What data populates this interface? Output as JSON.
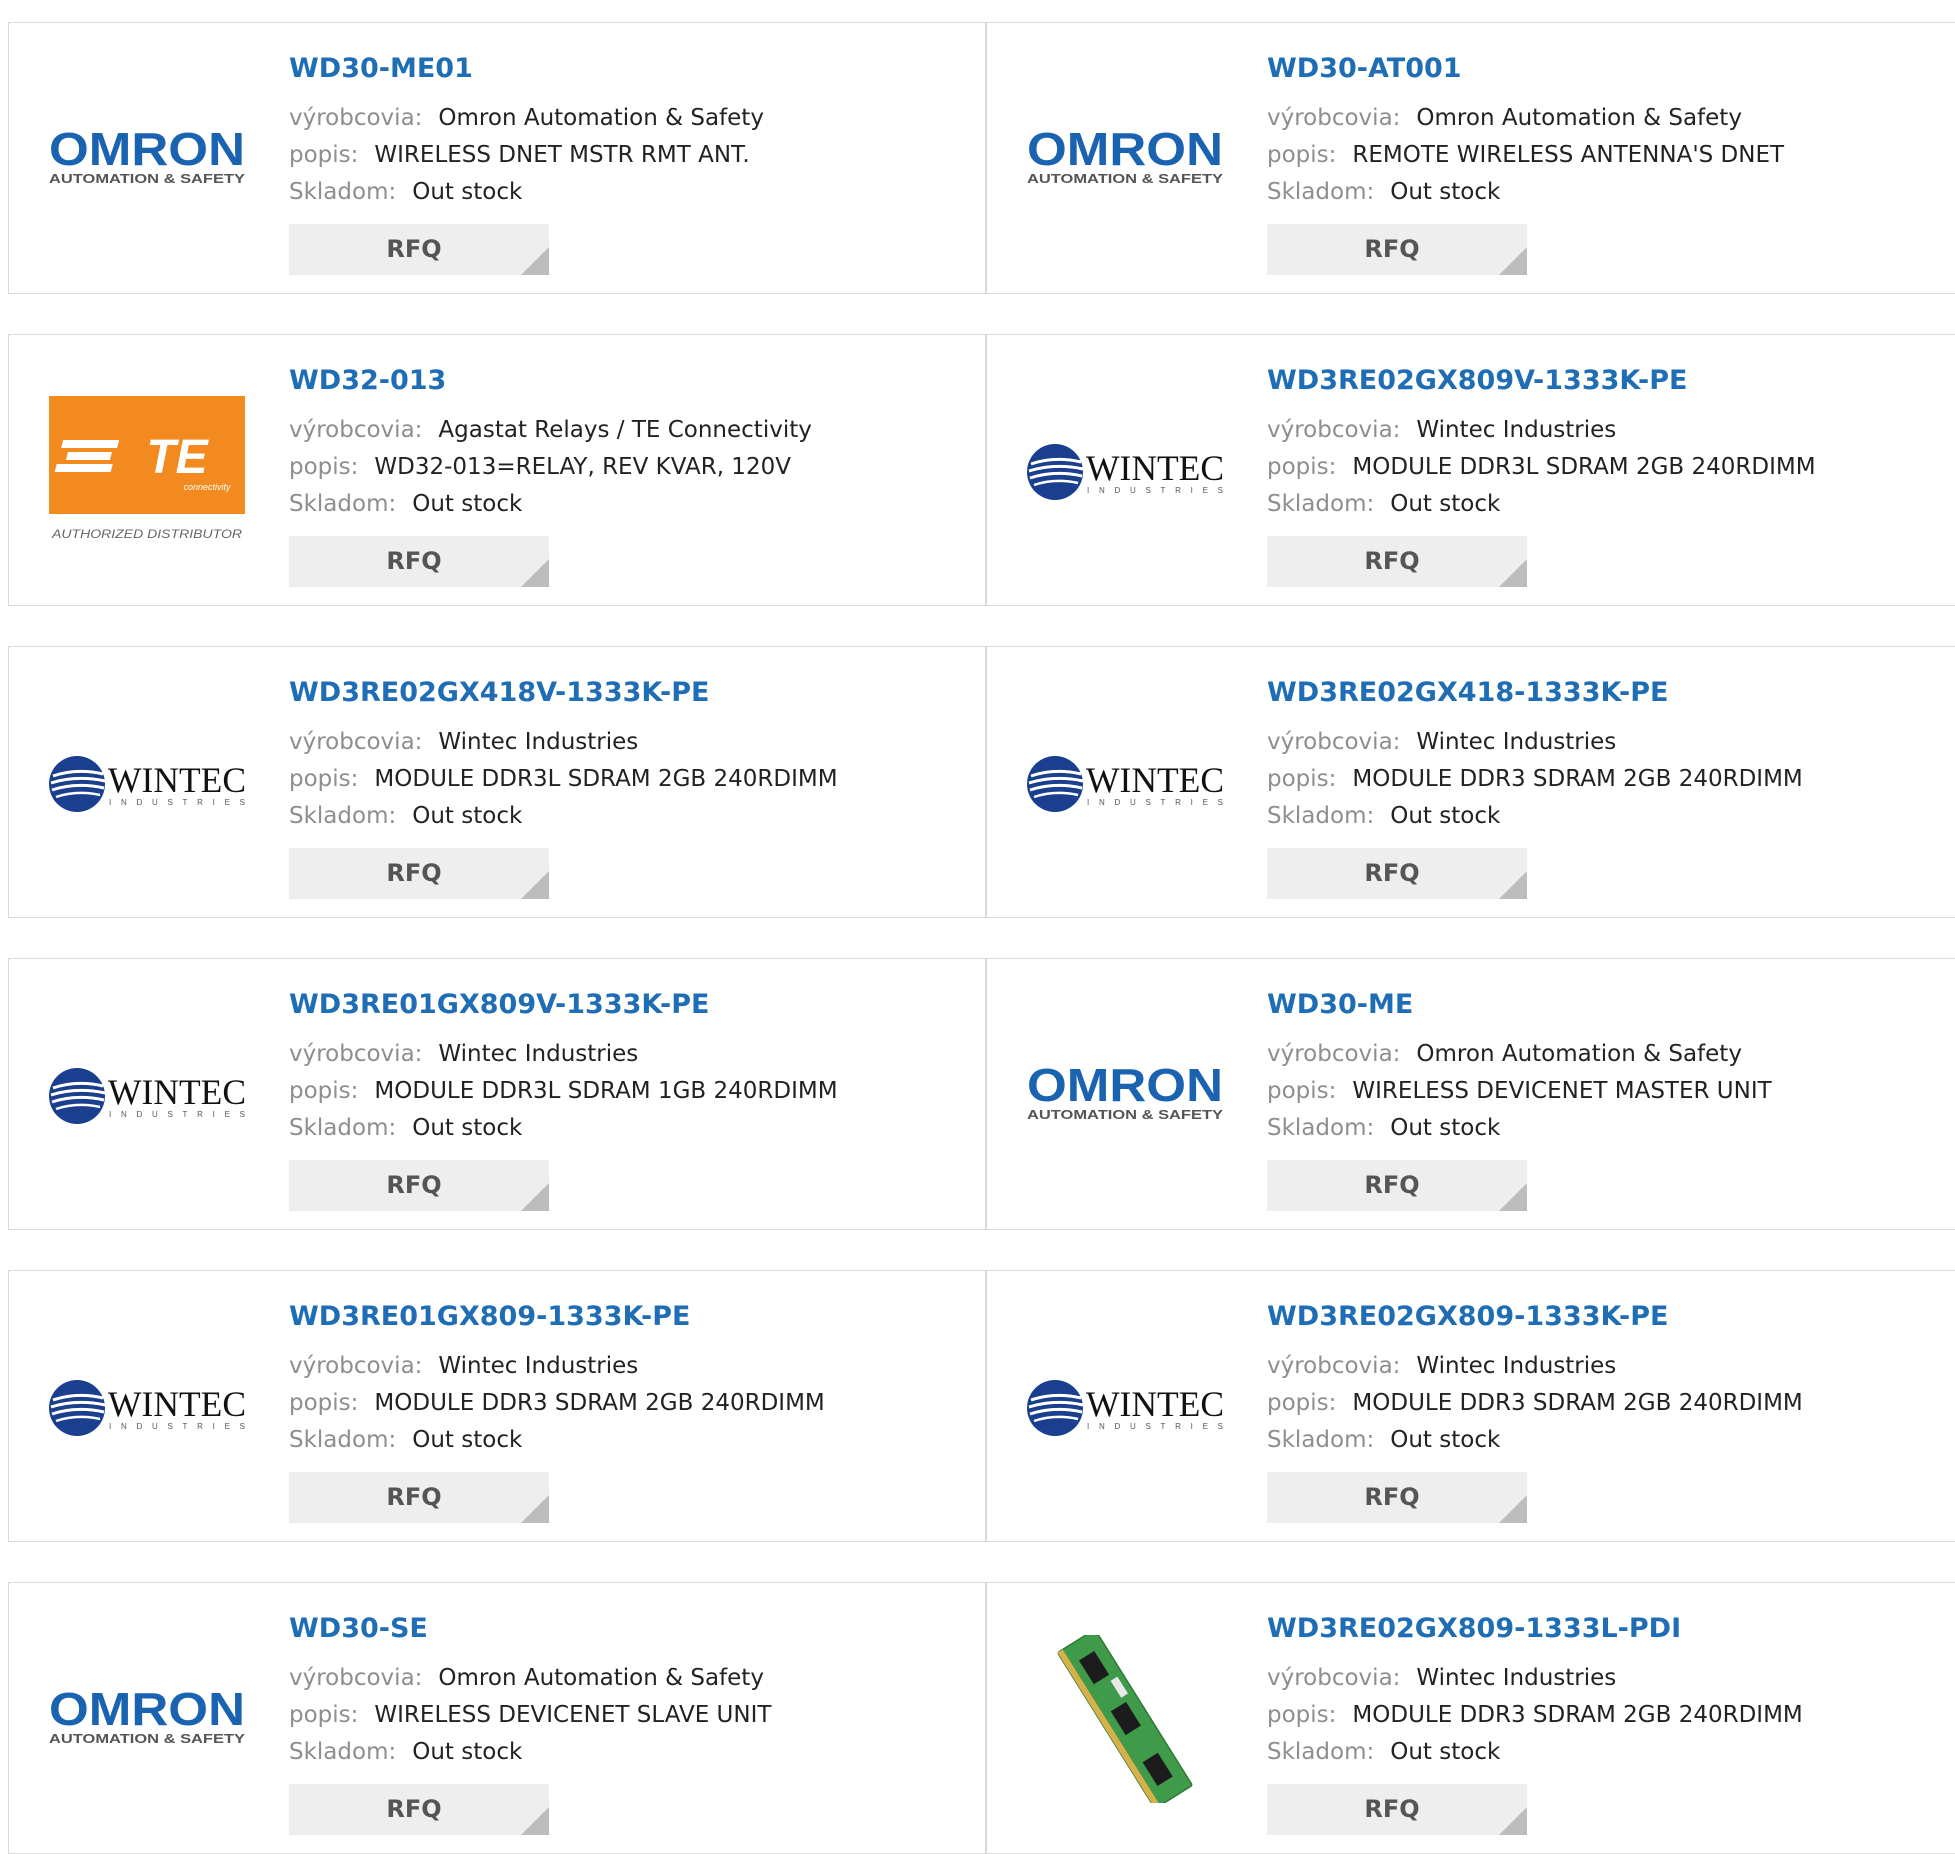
{
  "labels": {
    "manufacturer": "výrobcovia:",
    "description": "popis:",
    "stock": "Skladom:",
    "rfq": "RFQ"
  },
  "logo_text": {
    "omron_main": "OMRON",
    "omron_sub": "AUTOMATION & SAFETY",
    "wintec_main": "WINTEC",
    "wintec_sub": "INDUSTRIES",
    "te_main": "TE",
    "te_sub": "connectivity",
    "te_caption": "AUTHORIZED DISTRIBUTOR"
  },
  "colors": {
    "title_blue": "#1f6eb5",
    "omron_blue": "#1a63b0",
    "te_orange": "#f28a1f",
    "wintec_navy": "#1b3f8f",
    "button_bg": "#eeeeee"
  },
  "products": [
    {
      "part": "WD30-ME01",
      "logo": "omron",
      "manufacturer": "Omron Automation & Safety",
      "description": "WIRELESS DNET MSTR RMT ANT.",
      "stock": "Out stock"
    },
    {
      "part": "WD30-AT001",
      "logo": "omron",
      "manufacturer": "Omron Automation & Safety",
      "description": "REMOTE WIRELESS ANTENNA'S DNET",
      "stock": "Out stock"
    },
    {
      "part": "WD32-013",
      "logo": "te",
      "manufacturer": "Agastat Relays / TE Connectivity",
      "description": "WD32-013=RELAY, REV KVAR, 120V",
      "stock": "Out stock"
    },
    {
      "part": "WD3RE02GX809V-1333K-PE",
      "logo": "wintec",
      "manufacturer": "Wintec Industries",
      "description": "MODULE DDR3L SDRAM 2GB 240RDIMM",
      "stock": "Out stock"
    },
    {
      "part": "WD3RE02GX418V-1333K-PE",
      "logo": "wintec",
      "manufacturer": "Wintec Industries",
      "description": "MODULE DDR3L SDRAM 2GB 240RDIMM",
      "stock": "Out stock"
    },
    {
      "part": "WD3RE02GX418-1333K-PE",
      "logo": "wintec",
      "manufacturer": "Wintec Industries",
      "description": "MODULE DDR3 SDRAM 2GB 240RDIMM",
      "stock": "Out stock"
    },
    {
      "part": "WD3RE01GX809V-1333K-PE",
      "logo": "wintec",
      "manufacturer": "Wintec Industries",
      "description": "MODULE DDR3L SDRAM 1GB 240RDIMM",
      "stock": "Out stock"
    },
    {
      "part": "WD30-ME",
      "logo": "omron",
      "manufacturer": "Omron Automation & Safety",
      "description": "WIRELESS DEVICENET MASTER UNIT",
      "stock": "Out stock"
    },
    {
      "part": "WD3RE01GX809-1333K-PE",
      "logo": "wintec",
      "manufacturer": "Wintec Industries",
      "description": "MODULE DDR3 SDRAM 2GB 240RDIMM",
      "stock": "Out stock"
    },
    {
      "part": "WD3RE02GX809-1333K-PE",
      "logo": "wintec",
      "manufacturer": "Wintec Industries",
      "description": "MODULE DDR3 SDRAM 2GB 240RDIMM",
      "stock": "Out stock"
    },
    {
      "part": "WD30-SE",
      "logo": "omron",
      "manufacturer": "Omron Automation & Safety",
      "description": "WIRELESS DEVICENET SLAVE UNIT",
      "stock": "Out stock"
    },
    {
      "part": "WD3RE02GX809-1333L-PDI",
      "logo": "ram",
      "manufacturer": "Wintec Industries",
      "description": "MODULE DDR3 SDRAM 2GB 240RDIMM",
      "stock": "Out stock"
    }
  ]
}
